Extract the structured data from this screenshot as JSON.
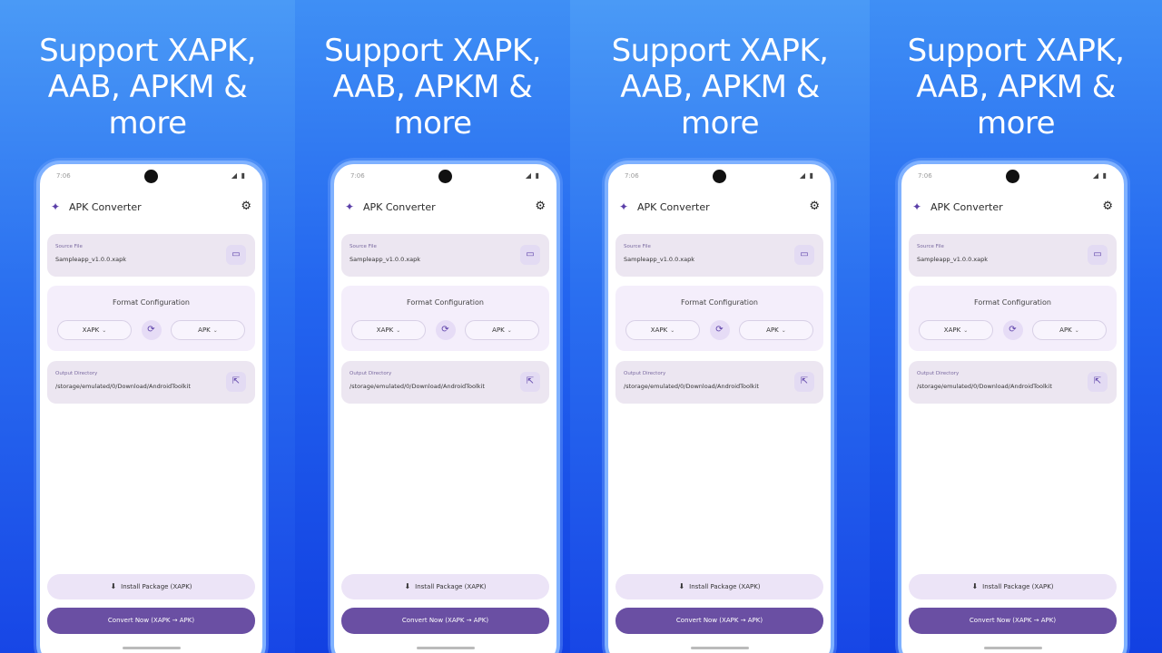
{
  "headline": "Support XAPK,\nAAB, APKM &\nmore",
  "status": {
    "time": "7:06",
    "icons": "◢ ▮"
  },
  "app": {
    "title": "APK Converter",
    "logo_icon": "sparkle-icon",
    "settings_icon": "gear-icon"
  },
  "source": {
    "label": "Source File",
    "value": "Sampleapp_v1.0.0.xapk",
    "action_icon": "folder-icon"
  },
  "format": {
    "title": "Format Configuration",
    "from": "XAPK",
    "to": "APK",
    "swap_icon": "swap-icon"
  },
  "output": {
    "label": "Output Directory",
    "value": "/storage/emulated/0/Download/AndroidToolkit",
    "action_icon": "open-external-icon"
  },
  "buttons": {
    "install": "Install Package (XAPK)",
    "convert": "Convert Now (XAPK → APK)"
  },
  "colors": {
    "accent": "#6a4fa3",
    "card": "#ece6f1",
    "background_top": "#4a9af6",
    "background_bottom": "#1746e6"
  }
}
